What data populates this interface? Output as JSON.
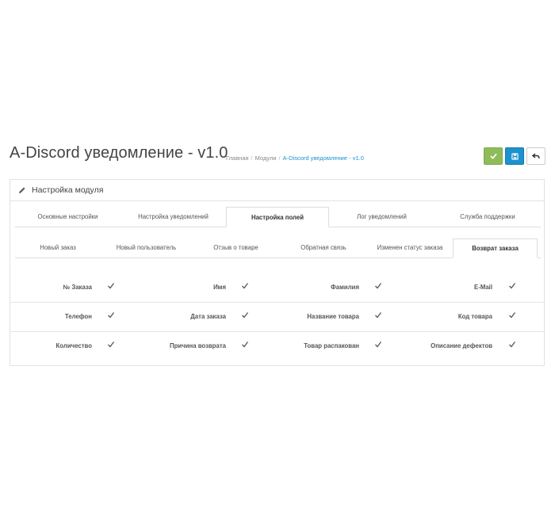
{
  "header": {
    "title": "A-Discord уведомление - v1.0",
    "breadcrumb": [
      {
        "label": "Главная",
        "active": false
      },
      {
        "label": "Модули",
        "active": false
      },
      {
        "label": "A-Discord уведомление - v1.0",
        "active": true
      }
    ],
    "buttons": [
      {
        "name": "save",
        "icon": "check-icon",
        "color": "#8fbb5a"
      },
      {
        "name": "save-alt",
        "icon": "floppy-icon",
        "color": "#1e91cf"
      },
      {
        "name": "back",
        "icon": "reply-icon",
        "color": "#ffffff"
      }
    ]
  },
  "panel": {
    "heading": "Настройка модуля",
    "heading_icon": "pencil-icon",
    "main_tabs": [
      {
        "label": "Основные настройки",
        "active": false
      },
      {
        "label": "Настройка уведомлений",
        "active": false
      },
      {
        "label": "Настройка полей",
        "active": true
      },
      {
        "label": "Лог уведомлений",
        "active": false
      },
      {
        "label": "Служба поддержки",
        "active": false
      }
    ],
    "sub_tabs": [
      {
        "label": "Новый заказ",
        "active": false
      },
      {
        "label": "Новый пользователь",
        "active": false
      },
      {
        "label": "Отзыв о товаре",
        "active": false
      },
      {
        "label": "Обратная связь",
        "active": false
      },
      {
        "label": "Изменен статус заказа",
        "active": false
      },
      {
        "label": "Возврат заказа",
        "active": true
      }
    ],
    "fields": [
      [
        {
          "label": "№ Заказа",
          "checked": true
        },
        {
          "label": "Имя",
          "checked": true
        },
        {
          "label": "Фамилия",
          "checked": true
        },
        {
          "label": "E-Mail",
          "checked": true
        }
      ],
      [
        {
          "label": "Телефон",
          "checked": true
        },
        {
          "label": "Дата заказа",
          "checked": true
        },
        {
          "label": "Название товара",
          "checked": true
        },
        {
          "label": "Код товара",
          "checked": true
        }
      ],
      [
        {
          "label": "Количество",
          "checked": true
        },
        {
          "label": "Причина возврата",
          "checked": true
        },
        {
          "label": "Товар распакован",
          "checked": true
        },
        {
          "label": "Описание дефектов",
          "checked": true
        }
      ]
    ]
  },
  "colors": {
    "accent_blue": "#1e91cf",
    "success_green": "#8fbb5a"
  }
}
